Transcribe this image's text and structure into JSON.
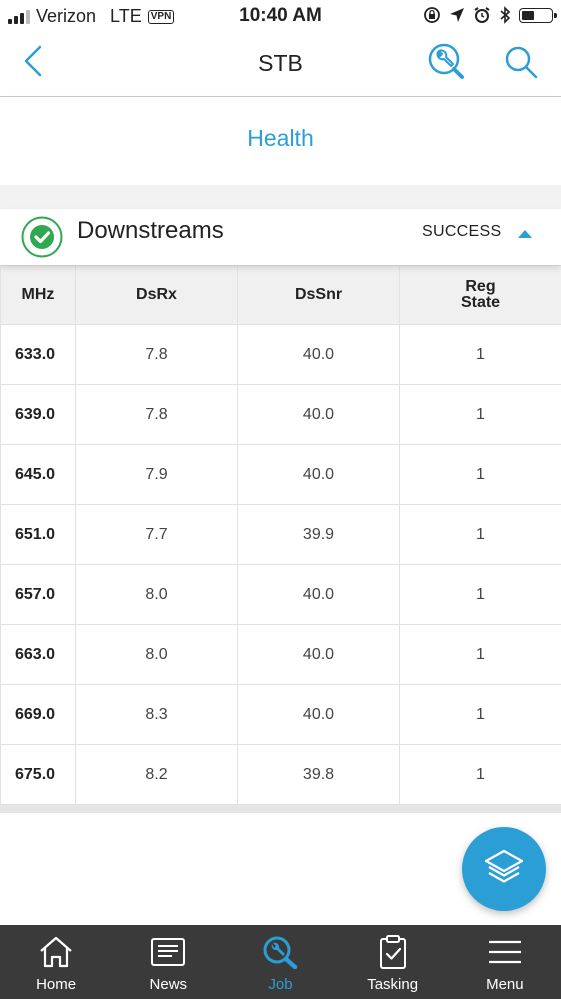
{
  "status_bar": {
    "carrier": "Verizon",
    "network": "LTE",
    "vpn": "VPN",
    "time": "10:40 AM",
    "battery_level": 0.45,
    "signal_bars": 3,
    "icons": [
      "orientation-lock-icon",
      "location-arrow-icon",
      "alarm-icon",
      "bluetooth-icon",
      "battery-icon"
    ]
  },
  "nav": {
    "title": "STB",
    "back_icon": "chevron-left-icon",
    "tool_icon": "wrench-magnifier-icon",
    "search_icon": "search-icon"
  },
  "health": {
    "title": "Health"
  },
  "downstreams": {
    "title": "Downstreams",
    "status": "SUCCESS",
    "status_icon": "check-circle-icon",
    "toggle_icon": "triangle-up-icon",
    "accent_color": "#2c9ed6",
    "success_color": "#2fa84f",
    "columns": [
      "MHz",
      "DsRx",
      "DsSnr",
      "Reg State"
    ],
    "rows": [
      {
        "mhz": "633.0",
        "dsrx": "7.8",
        "dssnr": "40.0",
        "reg": "1"
      },
      {
        "mhz": "639.0",
        "dsrx": "7.8",
        "dssnr": "40.0",
        "reg": "1"
      },
      {
        "mhz": "645.0",
        "dsrx": "7.9",
        "dssnr": "40.0",
        "reg": "1"
      },
      {
        "mhz": "651.0",
        "dsrx": "7.7",
        "dssnr": "39.9",
        "reg": "1"
      },
      {
        "mhz": "657.0",
        "dsrx": "8.0",
        "dssnr": "40.0",
        "reg": "1"
      },
      {
        "mhz": "663.0",
        "dsrx": "8.0",
        "dssnr": "40.0",
        "reg": "1"
      },
      {
        "mhz": "669.0",
        "dsrx": "8.3",
        "dssnr": "40.0",
        "reg": "1"
      },
      {
        "mhz": "675.0",
        "dsrx": "8.2",
        "dssnr": "39.8",
        "reg": "1"
      }
    ]
  },
  "fab": {
    "icon": "layers-icon"
  },
  "tabbar": {
    "active": "Job",
    "tabs": [
      {
        "label": "Home",
        "icon": "home-icon"
      },
      {
        "label": "News",
        "icon": "news-icon"
      },
      {
        "label": "Job",
        "icon": "wrench-magnifier-icon"
      },
      {
        "label": "Tasking",
        "icon": "clipboard-check-icon"
      },
      {
        "label": "Menu",
        "icon": "hamburger-menu-icon"
      }
    ]
  }
}
